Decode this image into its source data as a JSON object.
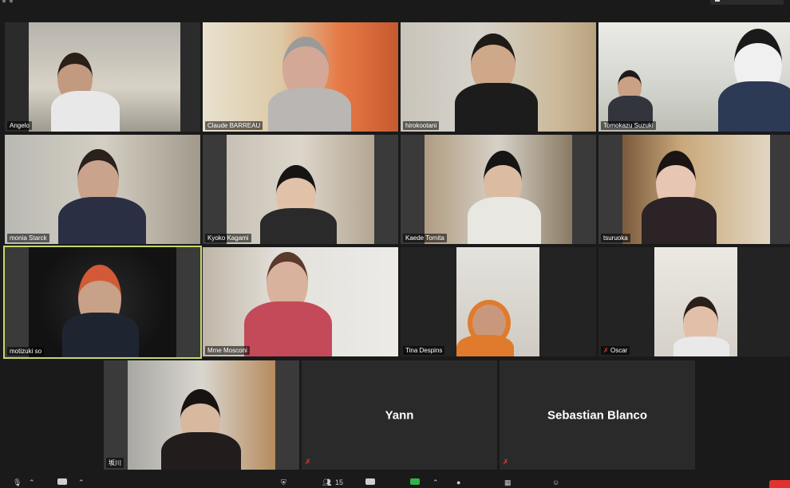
{
  "participants": {
    "angelo": "Angelo",
    "claude": "Claude BARREAU",
    "hiro": "hirokootani",
    "tomokazu": "Tomokazu Suzuki",
    "monia": "monia Starck",
    "kyoko": "Kyoko Kagami",
    "kaede": "Kaede Tomita",
    "tsuru": "tsuruoka",
    "motizuki": "motizuki so",
    "mosconi": "Mme Mosconi",
    "tina": "Tina Despins",
    "oscar": "Oscar",
    "sakagawa": "坂川",
    "yann": "Yann",
    "sebastian": "Sebastian Blanco"
  },
  "toolbar": {
    "participants_count": "15"
  },
  "colors": {
    "active_speaker_border": "#c5d86d",
    "muted_icon": "#e23a3a",
    "share_button": "#2fb34a",
    "end_button": "#e0322f"
  },
  "icons": {
    "mute": "mic-muted-icon",
    "microphone": "microphone-icon",
    "video": "video-camera-icon",
    "security": "shield-icon",
    "participants": "participants-icon",
    "chat": "chat-icon",
    "share": "share-screen-icon",
    "record": "record-icon",
    "apps": "apps-grid-icon",
    "reactions": "reactions-icon"
  }
}
